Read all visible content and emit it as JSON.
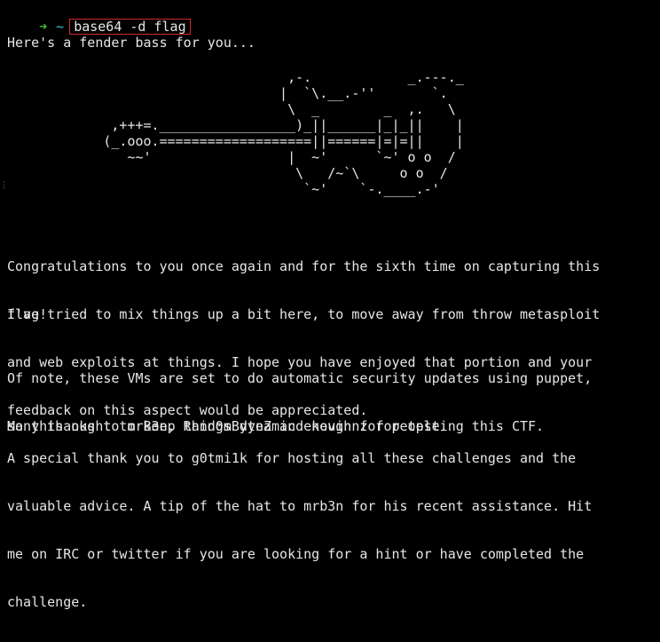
{
  "prompt": {
    "arrow": "➜",
    "cwd": "~",
    "command": "base64 -d flag"
  },
  "intro": "Here's a fender bass for you...",
  "ascii_art": "                                   ,-.            _.---._\n                                  |  `\\.__.-''       `.\n                                   \\  _        _  ,.   \\\n             ,+++=._________________)_||______|_|_||    |\n            (_.ooo.===================||======|=|=||    |\n               ~~'                 |  ~'      `~' o o  /\n                                    \\   /~`\\     o o  /\n                                     `~'    `-.____.-'",
  "paragraphs": [
    [
      "Congratulations to you once again and for the sixth time on capturing this",
      "flag!"
    ],
    [
      "I've tried to mix things up a bit here, to move away from throw metasploit",
      "and web exploits at things. I hope you have enjoyed that portion and your",
      "feedback on this aspect would be appreciated."
    ],
    [
      "Of note, these VMs are set to do automatic security updates using puppet,",
      "so this ought to keep things dynamic enough for people."
    ],
    [
      "Many thanks to mrB3n, Rand0mByteZ and kevinnz for testing this CTF."
    ],
    [
      "A special thank you to g0tmi1k for hosting all these challenges and the",
      "valuable advice. A tip of the hat to mrb3n for his recent assistance. Hit",
      "me on IRC or twitter if you are looking for a hint or have completed the",
      "challenge."
    ]
  ],
  "colors": {
    "background": "#000000",
    "text": "#e6e6e6",
    "prompt_arrow": "#3fbf3f",
    "prompt_cwd": "#37c6d6",
    "command_highlight_border": "#d22a2a"
  }
}
